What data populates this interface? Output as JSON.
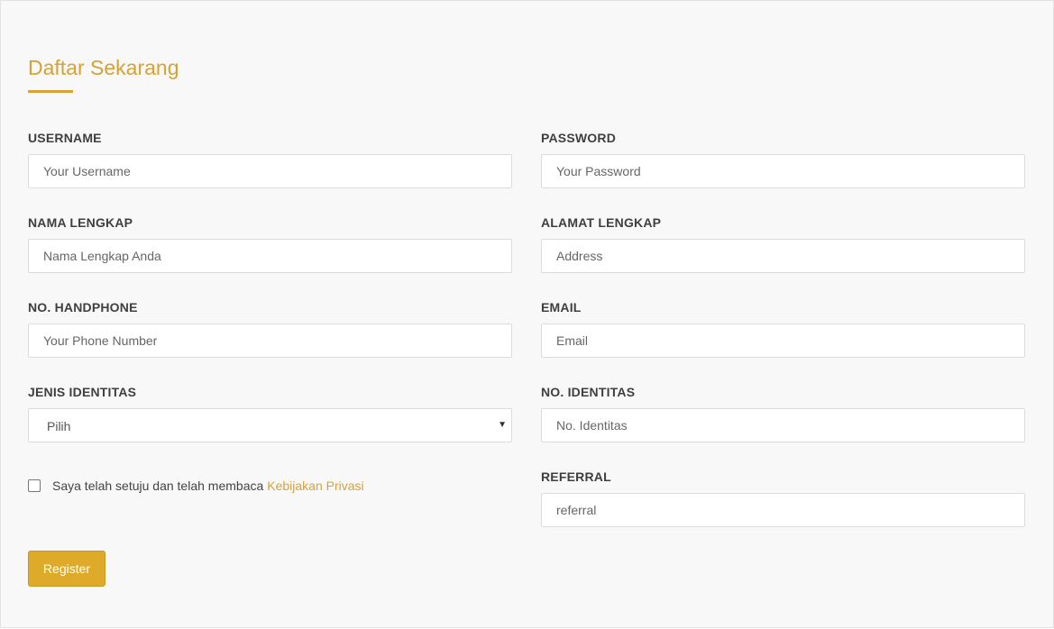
{
  "form": {
    "title": "Daftar Sekarang",
    "fields": {
      "username": {
        "label": "USERNAME",
        "placeholder": "Your Username"
      },
      "password": {
        "label": "PASSWORD",
        "placeholder": "Your Password"
      },
      "full_name": {
        "label": "NAMA LENGKAP",
        "placeholder": "Nama Lengkap Anda"
      },
      "address": {
        "label": "ALAMAT LENGKAP",
        "placeholder": "Address"
      },
      "phone": {
        "label": "NO. HANDPHONE",
        "placeholder": "Your Phone Number"
      },
      "email": {
        "label": "EMAIL",
        "placeholder": "Email"
      },
      "id_type": {
        "label": "JENIS IDENTITAS",
        "selected": "Pilih",
        "arrow": "▼"
      },
      "id_number": {
        "label": "NO. IDENTITAS",
        "placeholder": "No. Identitas"
      },
      "referral": {
        "label": "REFERRAL",
        "placeholder": "referral"
      }
    },
    "consent": {
      "text": "Saya telah setuju dan telah membaca",
      "link_text": "Kebijakan Privasi",
      "checked": false
    },
    "register_label": "Register"
  },
  "colors": {
    "accent": "#d6a235",
    "button": "#ddaa2a",
    "label": "#3f3f3f",
    "background": "#f8f8f8"
  }
}
